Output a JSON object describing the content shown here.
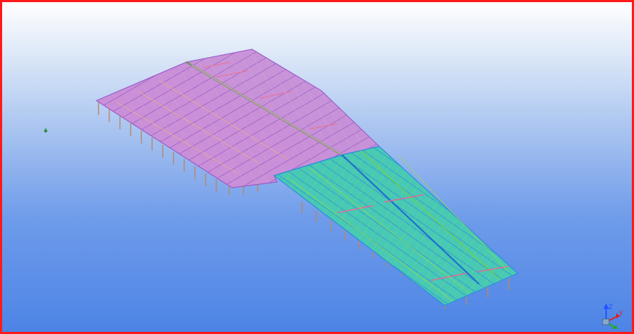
{
  "viewport": {
    "border_color": "#ff1a1a",
    "background_top": "#ffffff",
    "background_bottom": "#4d84e6"
  },
  "model": {
    "roof_color_building_a": "#c87ad6",
    "roof_color_building_b": "#2fbfae",
    "frame_color": "#d9a07a",
    "beam_color_a": "#9a5cc9",
    "beam_color_b": "#2d8de0",
    "accent_green": "#7ed321"
  },
  "axes": {
    "z_label": "Z",
    "y_label": "Y",
    "z_color": "#2255ff",
    "y_color": "#e02020",
    "x_color": "#22aa22"
  },
  "marker": {
    "icon": "point-marker-icon",
    "color": "#3aa655"
  }
}
